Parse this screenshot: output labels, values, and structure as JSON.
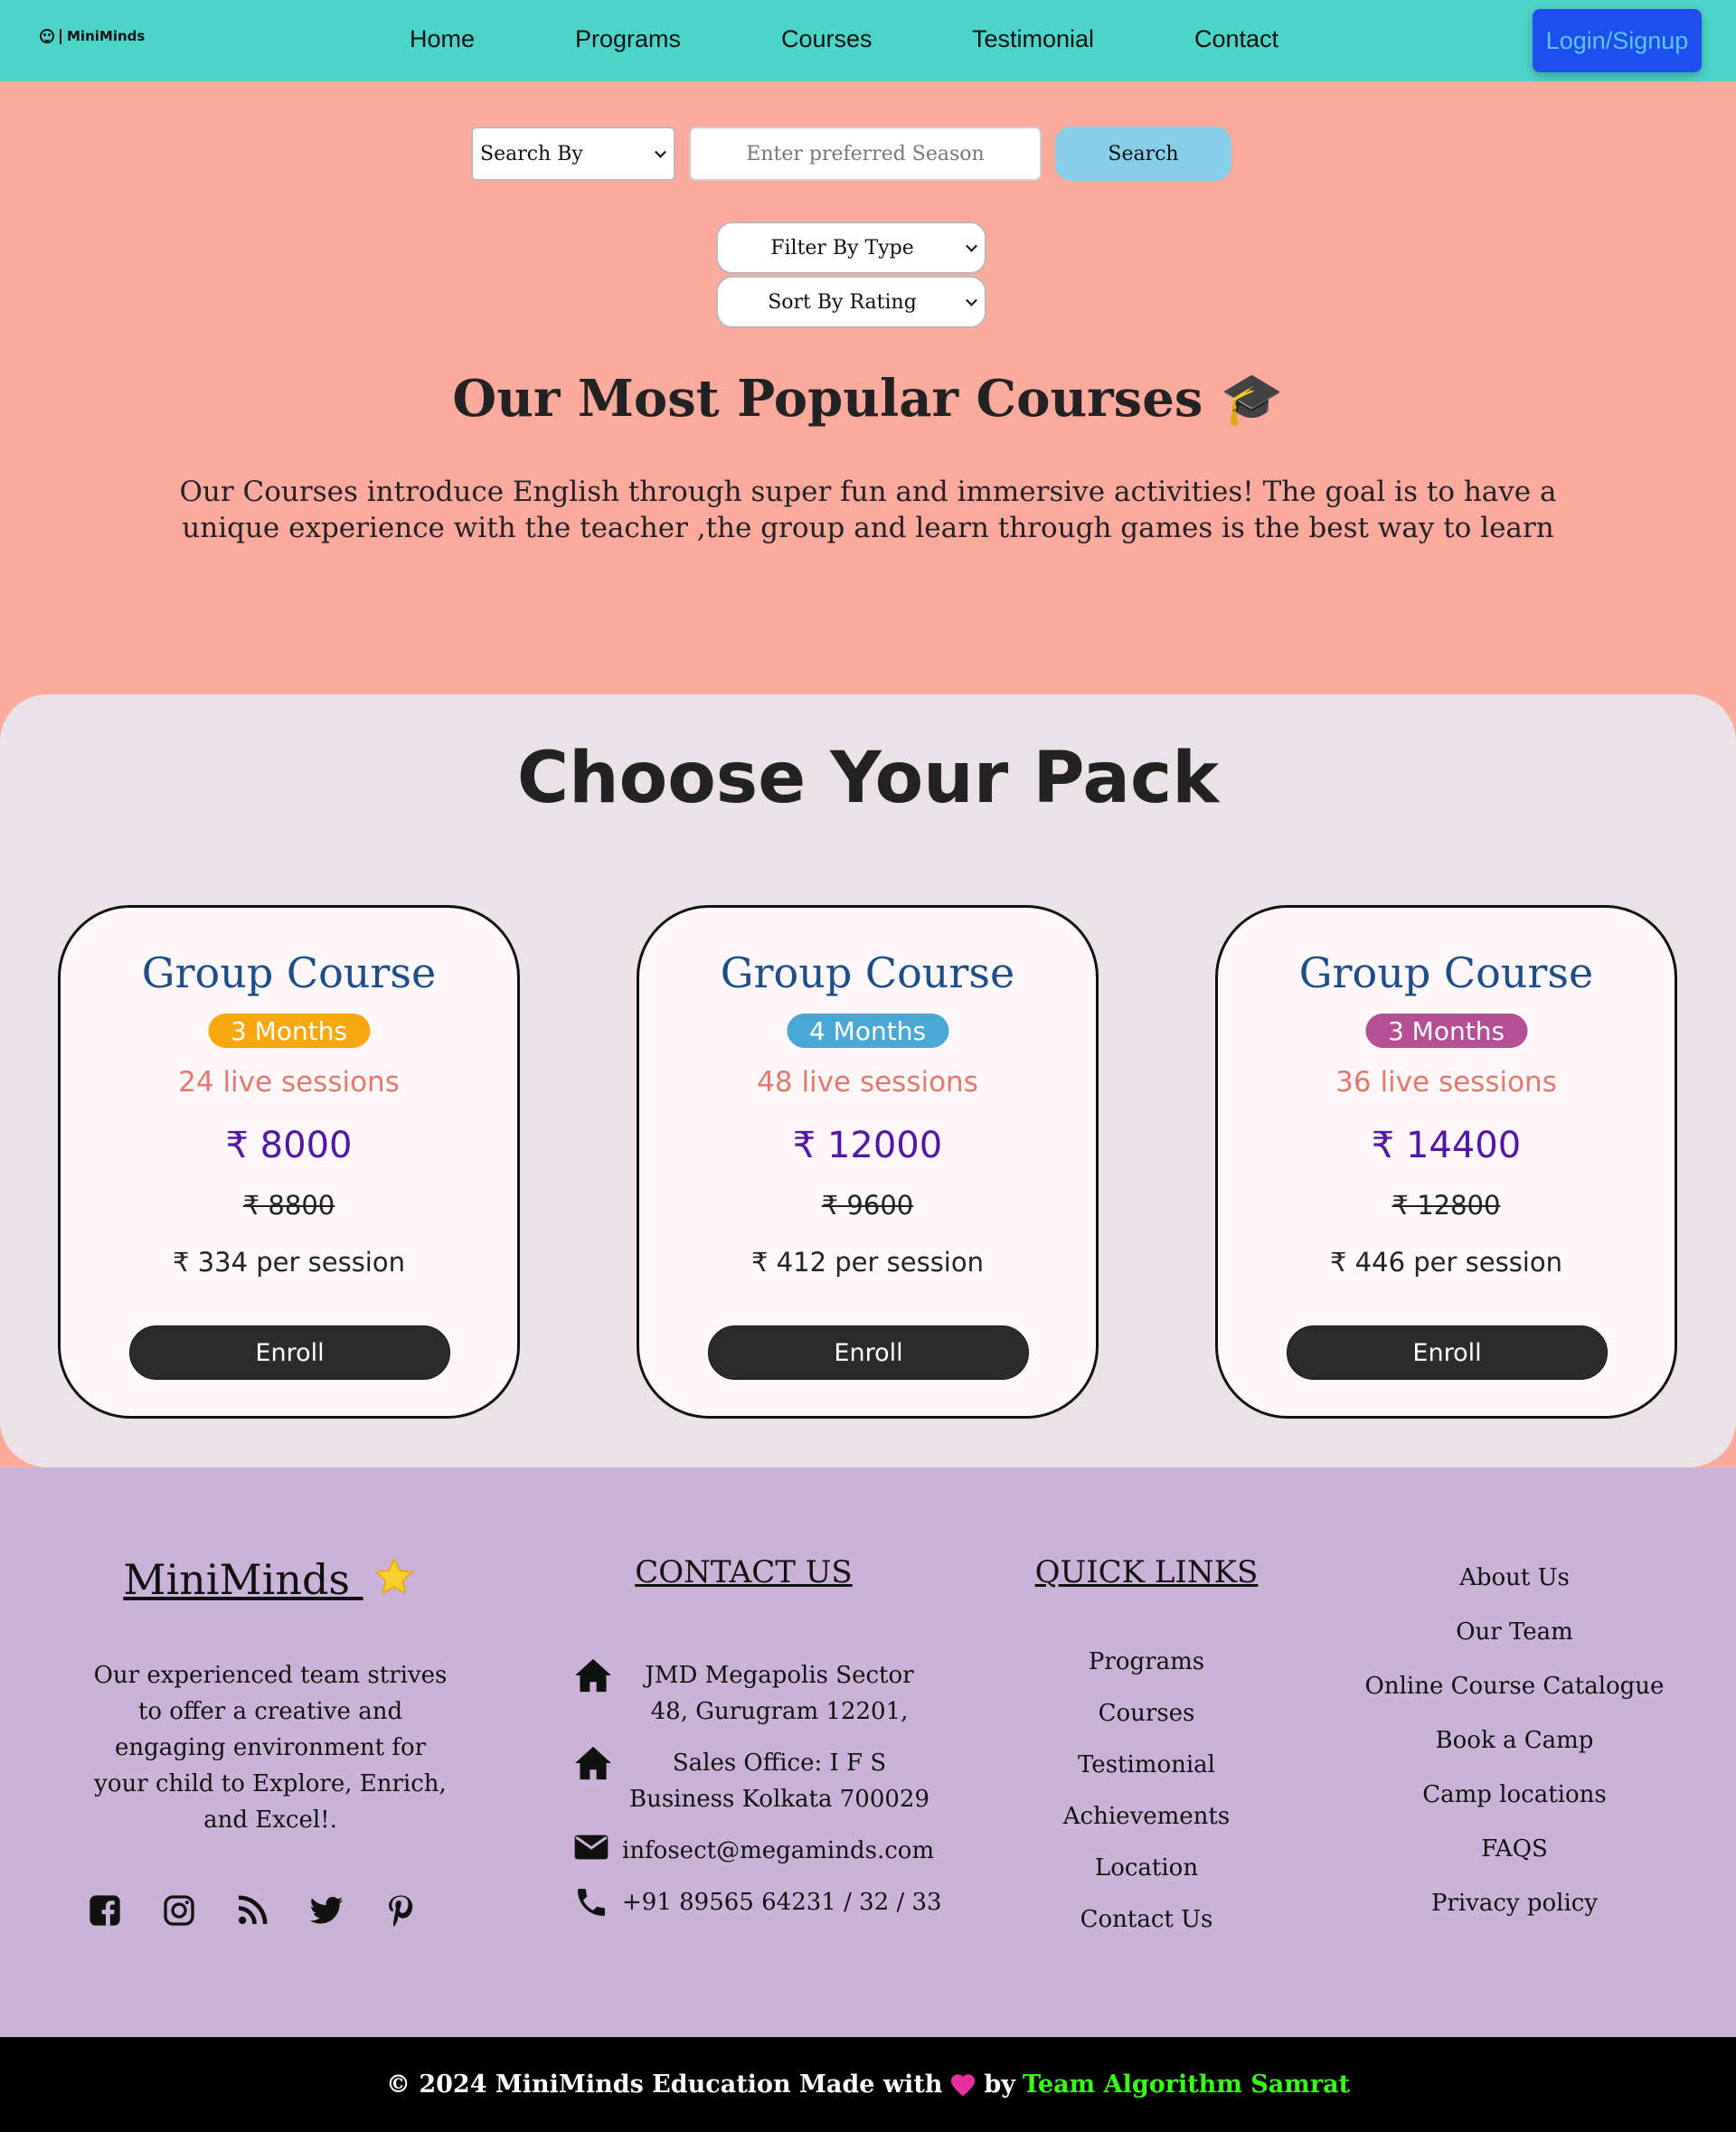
{
  "nav": {
    "logo_text": "MiniMinds",
    "links": [
      "Home",
      "Programs",
      "Courses",
      "Testimonial",
      "Contact"
    ],
    "login_label": "Login/Signup"
  },
  "search": {
    "search_by_label": "Search By",
    "input_placeholder": "Enter preferred Season",
    "button_label": "Search",
    "filter_label": "Filter By Type",
    "sort_label": "Sort By Rating"
  },
  "popular": {
    "title": "Our Most Popular Courses 🎓",
    "description": "Our Courses introduce English through super fun and immersive activities! The goal is to have a unique experience with the teacher ,the group and learn through games is the best way to learn"
  },
  "packs": {
    "title": "Choose Your Pack",
    "cards": [
      {
        "title": "Group Course",
        "duration": "3 Months",
        "badge_color": "#f9a80f",
        "sessions": "24 live sessions",
        "price": "₹ 8000",
        "old_price": "₹ 8800",
        "per_session": "₹ 334 per session",
        "button": "Enroll"
      },
      {
        "title": "Group Course",
        "duration": "4 Months",
        "badge_color": "#4ba8d6",
        "sessions": "48 live sessions",
        "price": "₹ 12000",
        "old_price": "₹ 9600",
        "per_session": "₹ 412 per session",
        "button": "Enroll"
      },
      {
        "title": "Group Course",
        "duration": "3 Months",
        "badge_color": "#b44f96",
        "sessions": "36 live sessions",
        "price": "₹ 14400",
        "old_price": "₹ 12800",
        "per_session": "₹ 446 per session",
        "button": "Enroll"
      }
    ]
  },
  "footer": {
    "brand": "MiniMinds",
    "about": "Our experienced team strives to offer a creative and engaging environment for your child to Explore, Enrich, and Excel!.",
    "social_icons": [
      "facebook-icon",
      "instagram-icon",
      "rss-icon",
      "twitter-icon",
      "pinterest-icon"
    ],
    "contact_heading": "CONTACT US",
    "address_1": "JMD Megapolis Sector 48, Gurugram 12201,",
    "address_2": "Sales Office: I F S Business Kolkata 700029",
    "email": "infosect@megaminds.com",
    "phone": "+91 89565 64231 / 32 / 33",
    "quick_links_heading": "QUICK LINKS",
    "quick_links": [
      "Programs",
      "Courses",
      "Testimonial",
      "Achievements",
      "Location",
      "Contact Us"
    ],
    "more_links": [
      "About Us",
      "Our Team",
      "Online Course Catalogue",
      "Book a Camp",
      "Camp locations",
      "FAQS",
      "Privacy policy"
    ]
  },
  "bottom_bar": {
    "prefix": "© 2024 MiniMinds Education Made with",
    "by": "by",
    "team": "Team Algorithm Samrat"
  }
}
